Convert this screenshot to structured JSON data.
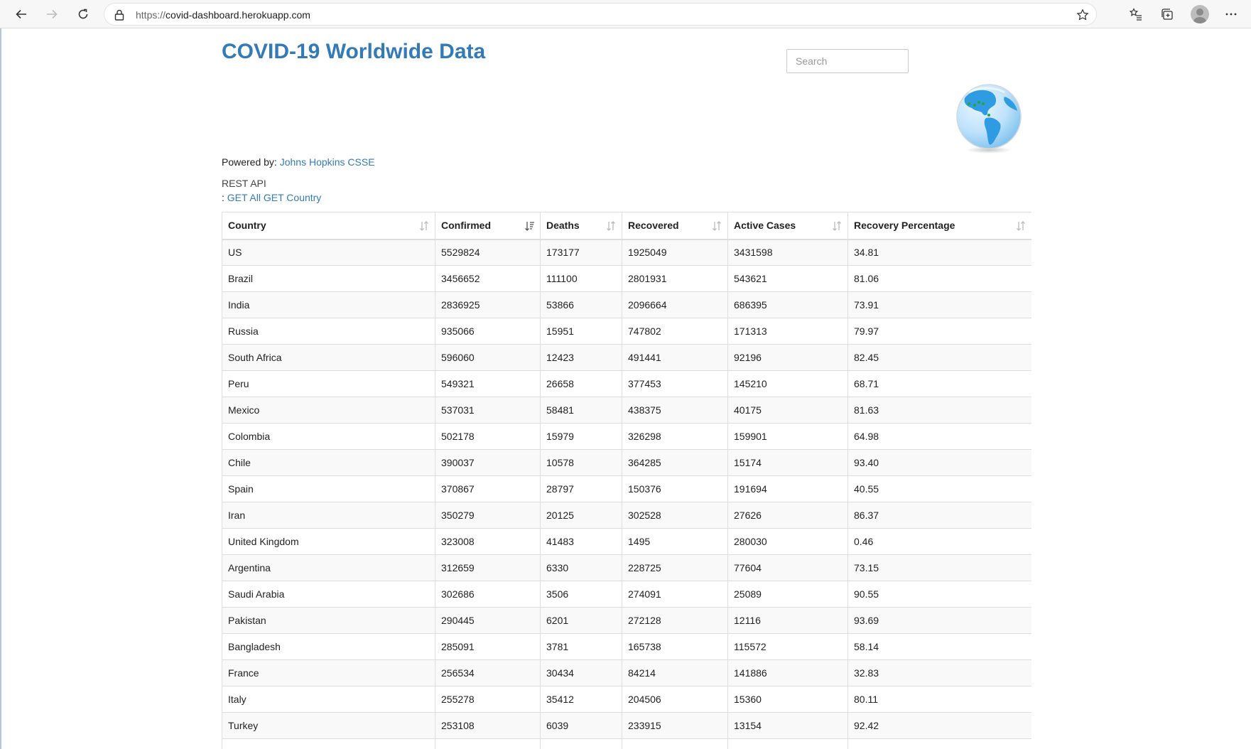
{
  "browser": {
    "url_scheme": "https://",
    "url_host": "covid-dashboard.herokuapp.com"
  },
  "page": {
    "title": "COVID-19 Worldwide Data",
    "search_placeholder": "Search",
    "powered_label": "Powered by: ",
    "powered_link": "Johns Hopkins CSSE",
    "api_label": "REST API",
    "api_prefix": ": ",
    "api_get_all": "GET All",
    "api_get_country": "GET Country",
    "accent_color": "#337ab7"
  },
  "table": {
    "columns": [
      "Country",
      "Confirmed",
      "Deaths",
      "Recovered",
      "Active Cases",
      "Recovery Percentage"
    ],
    "sorted_column": "Confirmed",
    "rows": [
      [
        "US",
        "5529824",
        "173177",
        "1925049",
        "3431598",
        "34.81"
      ],
      [
        "Brazil",
        "3456652",
        "111100",
        "2801931",
        "543621",
        "81.06"
      ],
      [
        "India",
        "2836925",
        "53866",
        "2096664",
        "686395",
        "73.91"
      ],
      [
        "Russia",
        "935066",
        "15951",
        "747802",
        "171313",
        "79.97"
      ],
      [
        "South Africa",
        "596060",
        "12423",
        "491441",
        "92196",
        "82.45"
      ],
      [
        "Peru",
        "549321",
        "26658",
        "377453",
        "145210",
        "68.71"
      ],
      [
        "Mexico",
        "537031",
        "58481",
        "438375",
        "40175",
        "81.63"
      ],
      [
        "Colombia",
        "502178",
        "15979",
        "326298",
        "159901",
        "64.98"
      ],
      [
        "Chile",
        "390037",
        "10578",
        "364285",
        "15174",
        "93.40"
      ],
      [
        "Spain",
        "370867",
        "28797",
        "150376",
        "191694",
        "40.55"
      ],
      [
        "Iran",
        "350279",
        "20125",
        "302528",
        "27626",
        "86.37"
      ],
      [
        "United Kingdom",
        "323008",
        "41483",
        "1495",
        "280030",
        "0.46"
      ],
      [
        "Argentina",
        "312659",
        "6330",
        "228725",
        "77604",
        "73.15"
      ],
      [
        "Saudi Arabia",
        "302686",
        "3506",
        "274091",
        "25089",
        "90.55"
      ],
      [
        "Pakistan",
        "290445",
        "6201",
        "272128",
        "12116",
        "93.69"
      ],
      [
        "Bangladesh",
        "285091",
        "3781",
        "165738",
        "115572",
        "58.14"
      ],
      [
        "France",
        "256534",
        "30434",
        "84214",
        "141886",
        "32.83"
      ],
      [
        "Italy",
        "255278",
        "35412",
        "204506",
        "15360",
        "80.11"
      ],
      [
        "Turkey",
        "253108",
        "6039",
        "233915",
        "13154",
        "92.42"
      ]
    ]
  }
}
